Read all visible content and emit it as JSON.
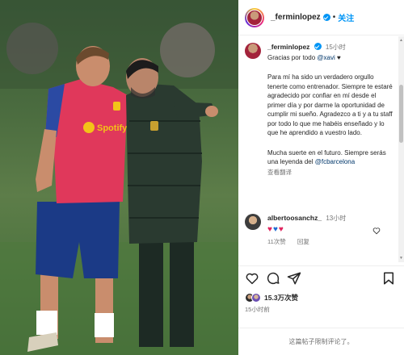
{
  "post": {
    "username": "_ferminlopez",
    "follow_separator": "•",
    "follow_label": "关注"
  },
  "caption": {
    "username": "_ferminlopez",
    "time": "15小时",
    "line1_prefix": "Gracias por todo ",
    "line1_mention": "@xavi",
    "line1_heart": "♥",
    "para1": "Para mí ha sido un verdadero orgullo tenerte como entrenador. Siempre te estaré agradecido por confiar en mí desde el primer día y por darme la oportunidad de cumplir mi sueño. Agradezco a ti y a tu staff por todo lo que me habéis enseñado y lo que he aprendido a vuestro lado.",
    "para2_prefix": "Mucha suerte en el futuro. Siempre serás una leyenda del ",
    "para2_mention": "@fcbarcelona",
    "see_translation": "查看翻译"
  },
  "comment": {
    "username": "albertoosanchz_",
    "time": "13小时",
    "likes": "11次赞",
    "reply": "回复"
  },
  "likes_count": "15.3万次赞",
  "posted_time": "15小时前",
  "comments_disabled": "这篇帖子限制评论了。",
  "photo": {
    "jersey_sponsor": "Spotify"
  },
  "colors": {
    "link": "#00376b",
    "follow": "#0095f6",
    "muted": "#737373"
  }
}
